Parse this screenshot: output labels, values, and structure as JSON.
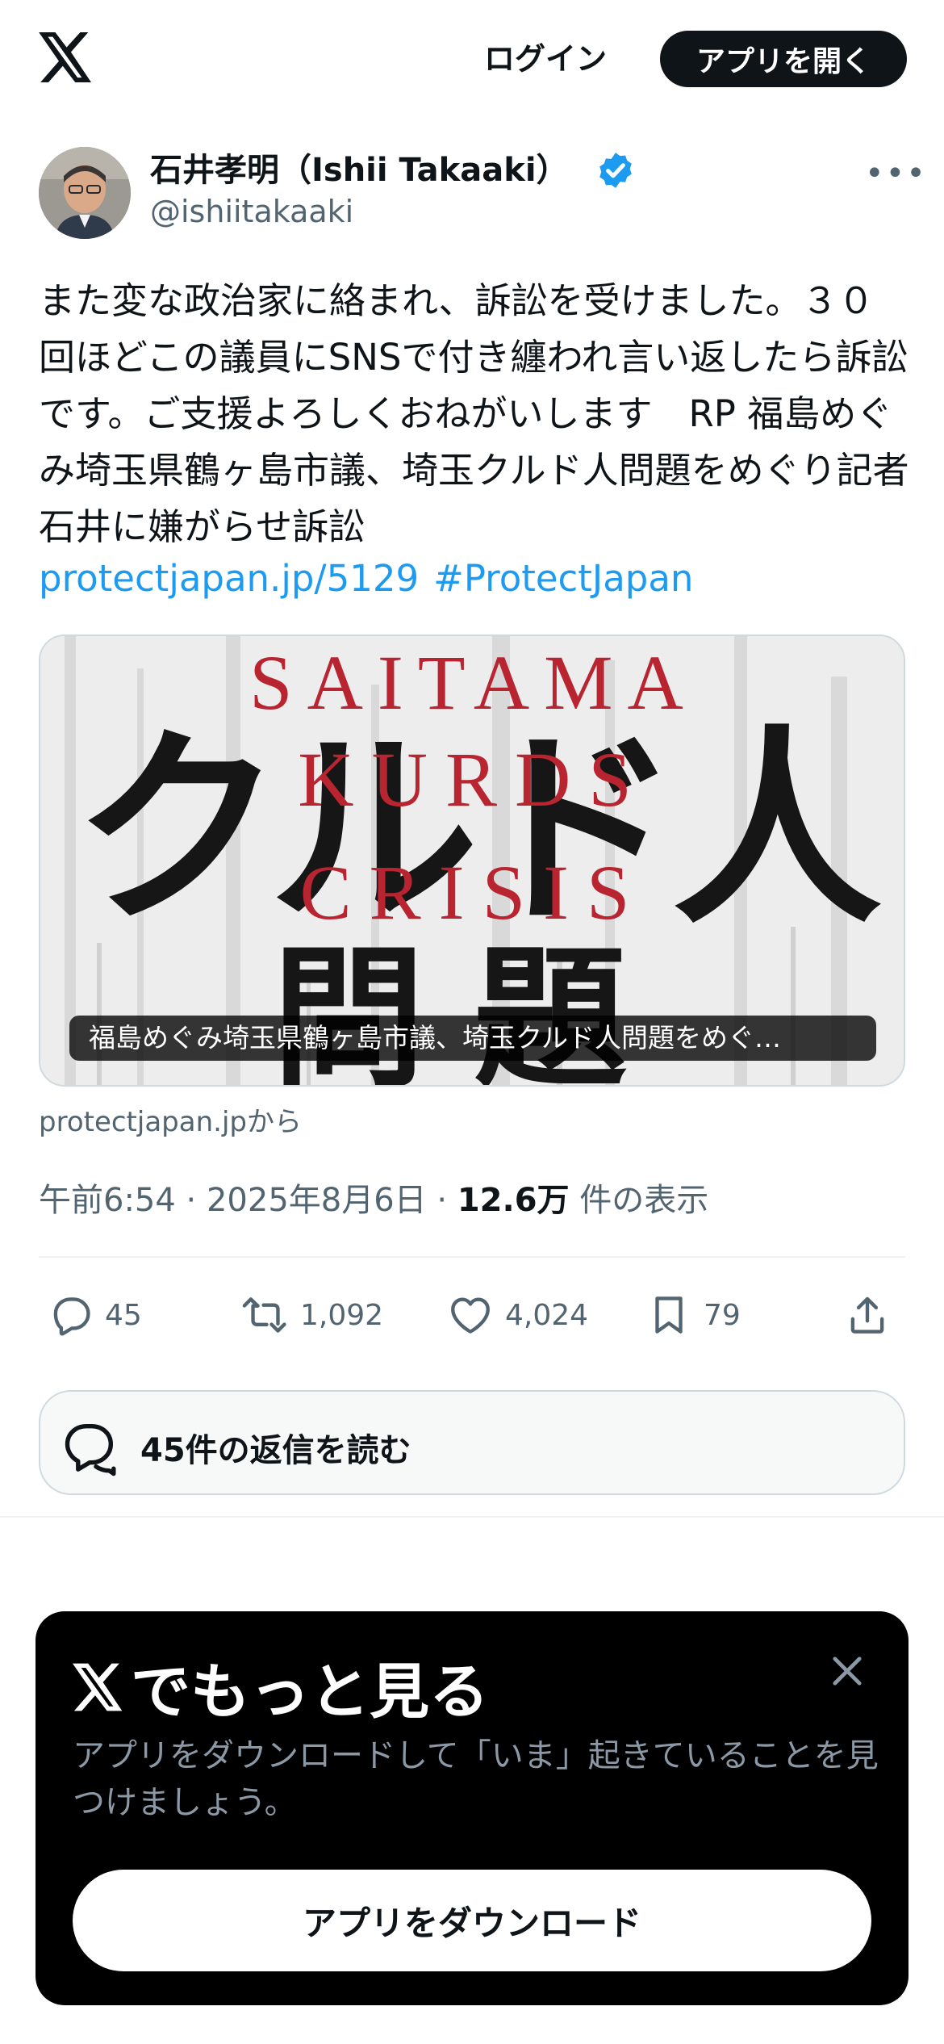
{
  "header": {
    "login_label": "ログイン",
    "open_app_label": "アプリを開く"
  },
  "author": {
    "display_name": "石井孝明（Ishii Takaaki）",
    "handle": "@ishiitakaaki",
    "verified_color": "#1d9bf0"
  },
  "tweet": {
    "text": "また変な政治家に絡まれ、訴訟を受けました。３０回ほどこの議員にSNSで付き纏われ言い返したら訴訟です。ご支援よろしくおねがいします　RP 福島めぐみ埼玉県鶴ヶ島市議、埼玉クルド人問題をめぐり記者石井に嫌がらせ訴訟",
    "link": "protectjapan.jp/5129",
    "hashtag": "#ProtectJapan"
  },
  "card": {
    "image_text_en_1": "SAITAMA",
    "image_text_en_2": "KURDS",
    "image_text_en_3": "CRISIS",
    "image_text_jp_1": "クルド人",
    "image_text_jp_2": "問題",
    "caption": "福島めぐみ埼玉県鶴ヶ島市議、埼玉クルド人問題をめぐ…",
    "source": "protectjapan.jpから"
  },
  "meta": {
    "time": "午前6:54",
    "sep1": " · ",
    "date": "2025年8月6日",
    "sep2": " · ",
    "views_count": "12.6万",
    "views_label": " 件の表示"
  },
  "actions": {
    "replies": "45",
    "reposts": "1,092",
    "likes": "4,024",
    "bookmarks": "79"
  },
  "read_replies_label": "45件の返信を読む",
  "promo": {
    "title": "でもっと見る",
    "description": "アプリをダウンロードして「いま」起きていることを見つけましょう。",
    "button_label": "アプリをダウンロード"
  }
}
